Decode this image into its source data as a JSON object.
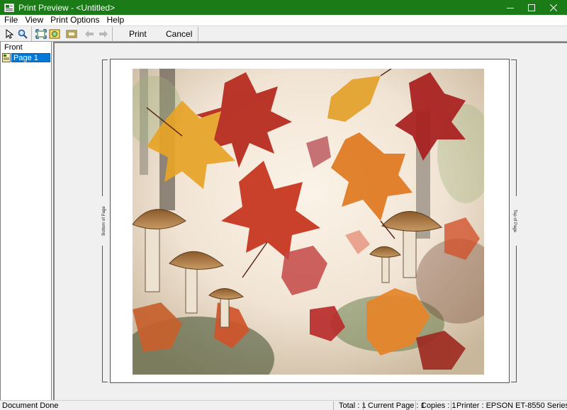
{
  "window": {
    "title": "Print Preview - <Untitled>",
    "minimize_glyph": "—",
    "maximize_glyph": "☐",
    "close_glyph": "✕"
  },
  "menu": [
    "File",
    "View",
    "Print Options",
    "Help"
  ],
  "toolbar": {
    "print_label": "Print",
    "cancel_label": "Cancel",
    "icons": [
      "pointer-icon",
      "zoom-icon",
      "fit-page-icon",
      "zoom-image-icon",
      "single-page-icon",
      "back-arrow-icon",
      "forward-arrow-icon"
    ]
  },
  "tree": {
    "root": "Front",
    "page": "Page 1"
  },
  "preview": {
    "left_edge_label": "Bottom of Page",
    "right_edge_label": "Top of Page",
    "image_description_icon": "autumn-leaves-mushrooms-watercolor"
  },
  "status": {
    "message": "Document Done",
    "total": "Total : 1",
    "current_page": "Current Page : 1",
    "copies": "Copies : 1",
    "printer": "Printer : EPSON ET-8550 Series"
  },
  "colors": {
    "title_bar": "#1a7b17",
    "selection": "#0078d7"
  }
}
